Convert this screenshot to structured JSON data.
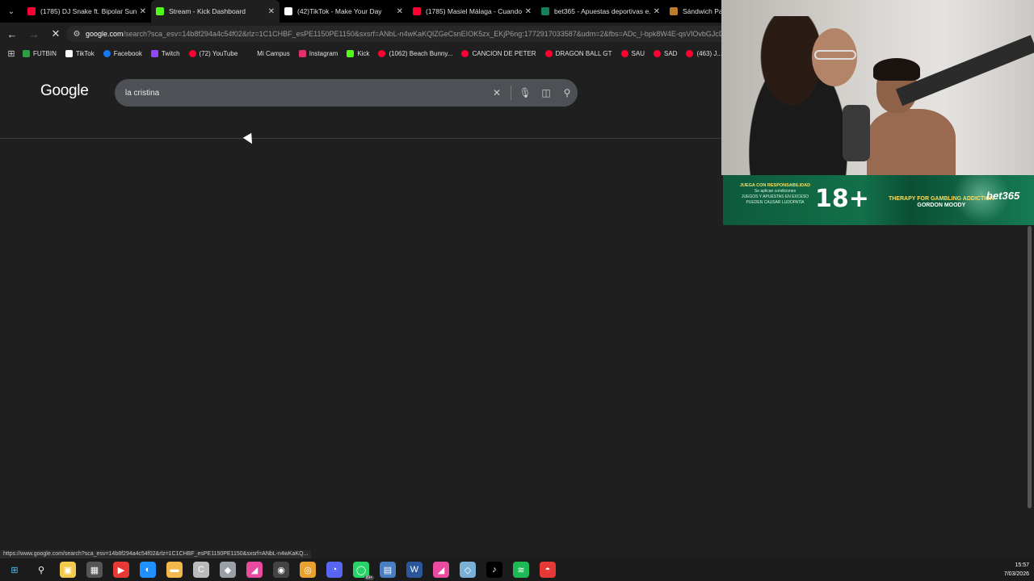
{
  "browser": {
    "tabs": [
      {
        "title": "(1785) DJ Snake ft. Bipolar Sun...",
        "color": "#ff0033",
        "active": false
      },
      {
        "title": "Stream - Kick Dashboard",
        "color": "#53fc18",
        "active": true
      },
      {
        "title": "(42)TikTok - Make Your Day",
        "color": "#ffffff",
        "active": false
      },
      {
        "title": "(1785) Masiel Málaga - Cuando...",
        "color": "#ff0033",
        "active": false
      },
      {
        "title": "bet365 - Apuestas deportivas e...",
        "color": "#14805e",
        "active": false
      },
      {
        "title": "Sándwich Paler...",
        "color": "#c07a2c",
        "active": false
      }
    ],
    "address": {
      "host": "google.com",
      "path": "/search?sca_esv=14b8f294a4c54f02&rlz=1C1CHBF_esPE1150PE1150&sxsrf=ANbL-n4wKaKQlZGeCsnEIOK5zx_EKjP6ng:1772917033587&udm=2&fbs=ADc_l-bpk8W4E-qsVlOvbGJcD"
    },
    "bookmarks": [
      {
        "label": "FUTBIN",
        "color": "#2e9e44",
        "shape": "square"
      },
      {
        "label": "TikTok",
        "color": "#ffffff",
        "shape": "square"
      },
      {
        "label": "Facebook",
        "color": "#1877f2",
        "shape": "play"
      },
      {
        "label": "Twitch",
        "color": "#9146ff",
        "shape": "square"
      },
      {
        "label": "(72) YouTube",
        "color": "#ff0033",
        "shape": "play"
      },
      {
        "label": "Mi Campus",
        "color": "#1f1f1f",
        "shape": "square"
      },
      {
        "label": "Instagram",
        "color": "#e1306c",
        "shape": "square"
      },
      {
        "label": "Kick",
        "color": "#53fc18",
        "shape": "square"
      },
      {
        "label": "(1062) Beach Bunny...",
        "color": "#ff0033",
        "shape": "play"
      },
      {
        "label": "CANCION DE PETER",
        "color": "#ff0033",
        "shape": "play"
      },
      {
        "label": "DRAGON BALL GT",
        "color": "#ff0033",
        "shape": "play"
      },
      {
        "label": "SAU",
        "color": "#ff0033",
        "shape": "play"
      },
      {
        "label": "SAD",
        "color": "#ff0033",
        "shape": "play"
      },
      {
        "label": "(463) J...",
        "color": "#ff0033",
        "shape": "play"
      }
    ],
    "status_url": "https://www.google.com/search?sca_esv=14b8f294a4c54f02&rlz=1C1CHBF_esPE1150PE1150&sxsrf=ANbL-n4wKaKQ..."
  },
  "google": {
    "logo": "Google",
    "query": "la cristina"
  },
  "banner": {
    "responsibility_title": "JUEGA CON RESPONSABILIDAD",
    "conditions": "Se aplican condiciones",
    "warning": "JUEGOS Y APUESTAS EN EXCESO PUEDEN CAUSAR LUDOPATÍA",
    "age": "18+",
    "therapy": "THERAPY FOR GAMBLING ADDICTION",
    "charity": "GORDON MOODY",
    "brand": "bet365"
  },
  "taskbar": {
    "icons": [
      {
        "name": "start",
        "glyph": "⊞",
        "color": "#4cc2ff"
      },
      {
        "name": "search",
        "glyph": "⚲",
        "color": "#ffffff"
      },
      {
        "name": "store",
        "glyph": "▣",
        "color": "#f2c94c"
      },
      {
        "name": "gamepad",
        "glyph": "▦",
        "color": "#555555"
      },
      {
        "name": "media",
        "glyph": "▶",
        "color": "#e53935"
      },
      {
        "name": "edge",
        "glyph": "◐",
        "color": "#1e90ff"
      },
      {
        "name": "files",
        "glyph": "▬",
        "color": "#f2b84b"
      },
      {
        "name": "app-c",
        "glyph": "C",
        "color": "#bbbbbb"
      },
      {
        "name": "capture",
        "glyph": "◆",
        "color": "#9aa0a6"
      },
      {
        "name": "app-pink",
        "glyph": "◢",
        "color": "#e94ba0"
      },
      {
        "name": "obs",
        "glyph": "◉",
        "color": "#444444"
      },
      {
        "name": "chrome",
        "glyph": "◎",
        "color": "#e8a02e"
      },
      {
        "name": "discord",
        "glyph": "◔",
        "color": "#5865f2"
      },
      {
        "name": "whatsapp",
        "glyph": "◯",
        "color": "#25d366"
      },
      {
        "name": "calculator",
        "glyph": "▤",
        "color": "#4a7ec0"
      },
      {
        "name": "word",
        "glyph": "W",
        "color": "#2b579a"
      },
      {
        "name": "app-pink-2",
        "glyph": "◢",
        "color": "#e94ba0"
      },
      {
        "name": "tool",
        "glyph": "◇",
        "color": "#7ab0d6"
      },
      {
        "name": "tiktok",
        "glyph": "♪",
        "color": "#000000"
      },
      {
        "name": "spotify",
        "glyph": "≋",
        "color": "#1db954"
      },
      {
        "name": "app-red",
        "glyph": "◓",
        "color": "#e53935"
      }
    ],
    "badge": "99+",
    "time": "15:57",
    "date": "7/03/2026"
  }
}
